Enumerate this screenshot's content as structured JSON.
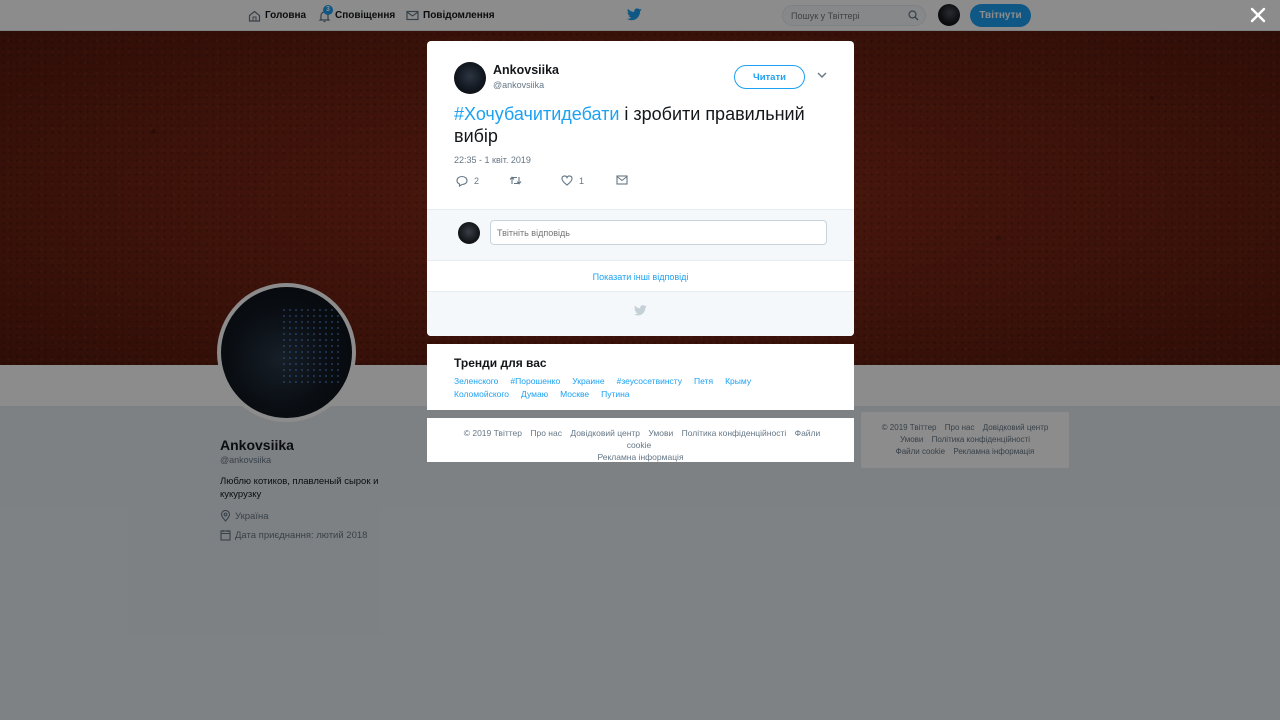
{
  "nav": {
    "home_label": "Головна",
    "notifications_label": "Сповіщення",
    "notifications_badge": "3",
    "messages_label": "Повідомлення",
    "search_placeholder": "Пошук у Твіттері",
    "tweet_button": "Твітнути"
  },
  "profile": {
    "name": "Ankovsiika",
    "handle": "@ankovsiika",
    "bio": "Люблю котиков, плавленый сырок и кукурузку",
    "location": "Україна",
    "joined": "Дата приєднання: лютий 2018"
  },
  "tweet": {
    "author_name": "Ankovsiika",
    "author_handle": "@ankovsiika",
    "follow_label": "Читати",
    "hashtag": "#Хочубачитидебати",
    "text": " і зробити правильний вибір",
    "time": "22:35 - 1 квіт. 2019",
    "replies": "2",
    "retweets": "",
    "likes": "1",
    "reply_placeholder": "Твітніть відповідь",
    "show_more": "Показати інші відповіді"
  },
  "trends": {
    "title": "Тренди для вас",
    "items": [
      "Зеленского",
      "#Порошенко",
      "Украине",
      "#зеусосетвинсту",
      "Петя",
      "Крыму",
      "Коломойского",
      "Думаю",
      "Москве",
      "Путина"
    ]
  },
  "footer": {
    "items": [
      "© 2019 Твіттер",
      "Про нас",
      "Довідковий центр",
      "Умови",
      "Політика конфіденційності",
      "Файли cookie",
      "Рекламна інформація"
    ]
  },
  "colors": {
    "accent": "#1da1f2",
    "banner": "#6e2213"
  }
}
